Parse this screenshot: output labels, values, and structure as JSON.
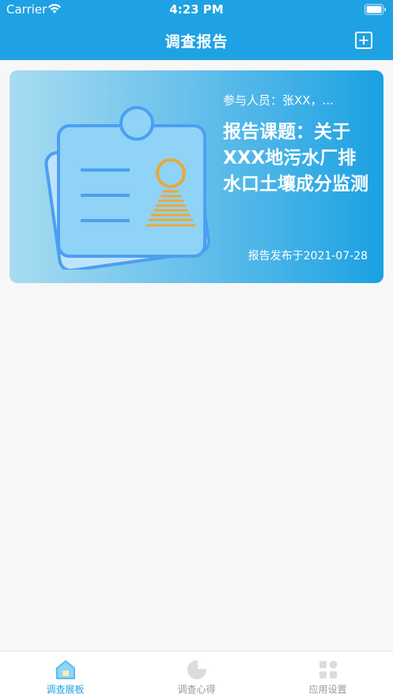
{
  "status_bar": {
    "carrier": "Carrier",
    "time": "4:23 PM"
  },
  "nav": {
    "title": "调查报告",
    "add_icon": "plus-square-icon"
  },
  "report_card": {
    "participants": "参与人员：张XX，...",
    "topic": "报告课题：关于XXX地污水厂排水口土壤成分监测",
    "published": "报告发布于2021-07-28"
  },
  "tabbar": {
    "tabs": [
      {
        "label": "调查展板",
        "icon": "home-icon",
        "active": true
      },
      {
        "label": "调查心得",
        "icon": "pie-chart-icon",
        "active": false
      },
      {
        "label": "应用设置",
        "icon": "apps-grid-icon",
        "active": false
      }
    ]
  },
  "colors": {
    "primary": "#1fa2e3",
    "tab_inactive": "#999999"
  }
}
